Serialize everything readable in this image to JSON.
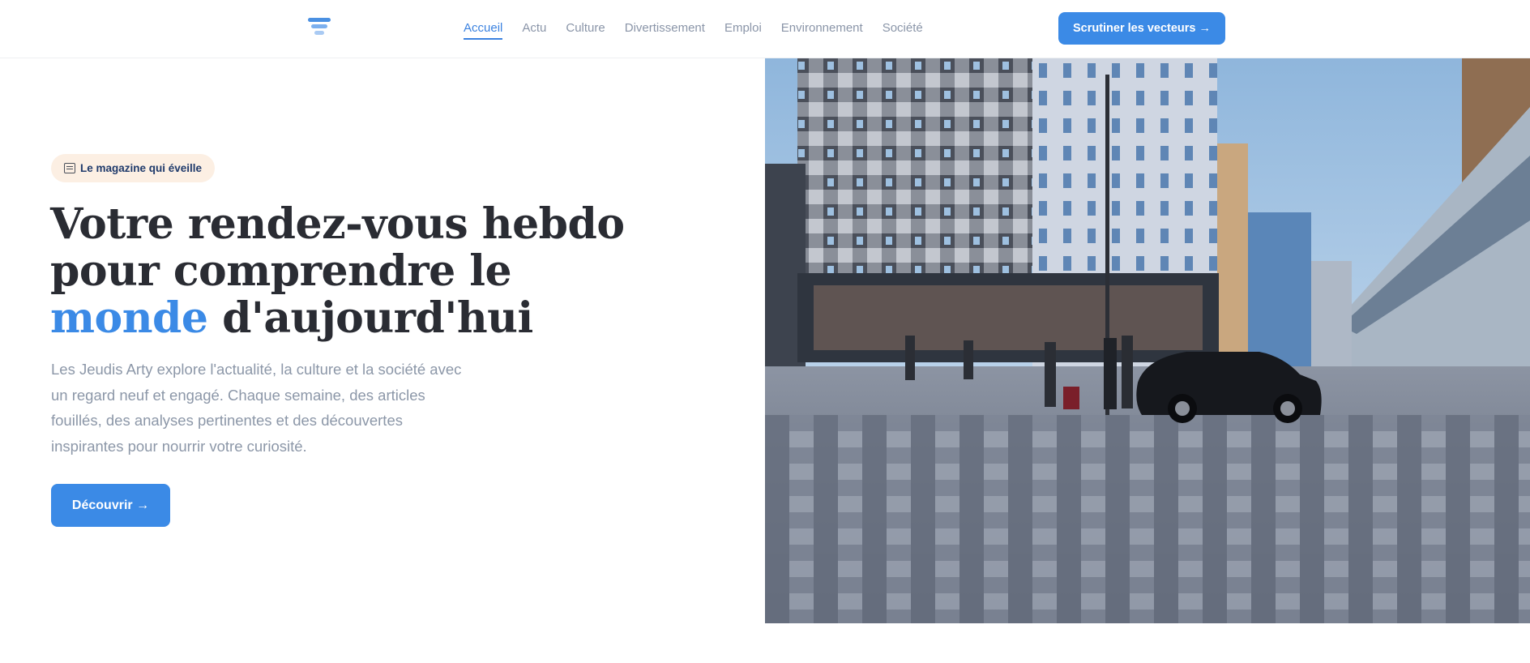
{
  "header": {
    "nav": [
      {
        "label": "Accueil",
        "active": true
      },
      {
        "label": "Actu",
        "active": false
      },
      {
        "label": "Culture",
        "active": false
      },
      {
        "label": "Divertissement",
        "active": false
      },
      {
        "label": "Emploi",
        "active": false
      },
      {
        "label": "Environnement",
        "active": false
      },
      {
        "label": "Société",
        "active": false
      }
    ],
    "cta_label": "Scrutiner les vecteurs →"
  },
  "hero": {
    "badge_label": "Le magazine qui éveille",
    "title_part1": "Votre rendez-vous hebdo pour comprendre le ",
    "title_accent": "monde",
    "title_part2": " d'aujourd'hui",
    "description": "Les Jeudis Arty explore l'actualité, la culture et la société avec un regard neuf et engagé. Chaque semaine, des articles fouillés, des analyses pertinentes et des découvertes inspirantes pour nourrir votre curiosité.",
    "cta_label": "Découvrir →"
  },
  "colors": {
    "accent": "#3b8ae6",
    "badge_bg": "#fcefe3",
    "nav_inactive": "#8a95a8"
  }
}
